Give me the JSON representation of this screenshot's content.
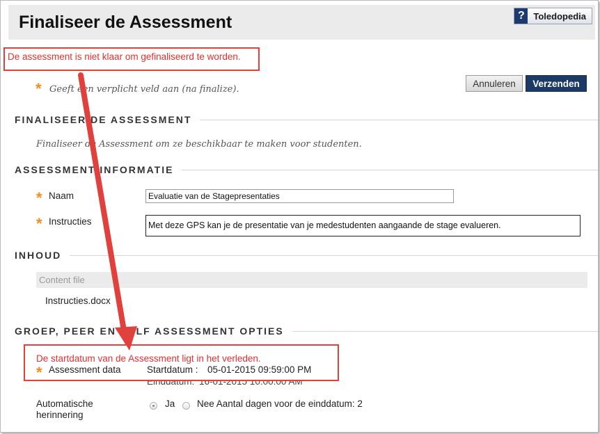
{
  "page": {
    "title": "Finaliseer de Assessment",
    "help_label": "Toledopedia",
    "help_icon": "question-icon"
  },
  "errors": {
    "top": "De assessment is niet klaar om gefinaliseerd te worden.",
    "dates": "De startdatum van de Assessment ligt in het verleden."
  },
  "required_note": {
    "star": "*",
    "text": "Geeft een verplicht veld aan (na finalize)."
  },
  "buttons": {
    "cancel": "Annuleren",
    "submit": "Verzenden"
  },
  "sections": {
    "finalize": {
      "title": "FINALISEER DE ASSESSMENT",
      "description": "Finaliseer de Assessment om ze beschikbaar te maken voor studenten."
    },
    "info": {
      "title": "ASSESSMENT INFORMATIE",
      "name_label": "Naam",
      "name_value": "Evaluatie van de Stagepresentaties",
      "instructions_label": "Instructies",
      "instructions_value": "Met deze GPS kan je de presentatie van je medestudenten aangaande de stage evalueren."
    },
    "content": {
      "title": "INHOUD",
      "column_header": "Content file",
      "file": "Instructies.docx"
    },
    "options": {
      "title": "GROEP, PEER EN SELF ASSESSMENT OPTIES",
      "dates_label": "Assessment data",
      "start_label": "Startdatum :",
      "start_value": "05-01-2015 09:59:00 PM",
      "end_label": "Einddatum:",
      "end_value": "16-01-2015 10:00:00 AM",
      "reminder_label_1": "Automatische",
      "reminder_label_2": "herinnering",
      "reminder_yes": "Ja",
      "reminder_no": "Nee Aantal dagen voor de einddatum: 2"
    }
  },
  "colors": {
    "error": "#e03030",
    "annotation": "#e0413d",
    "required": "#f28c1c",
    "primary_button": "#1d3a66"
  }
}
